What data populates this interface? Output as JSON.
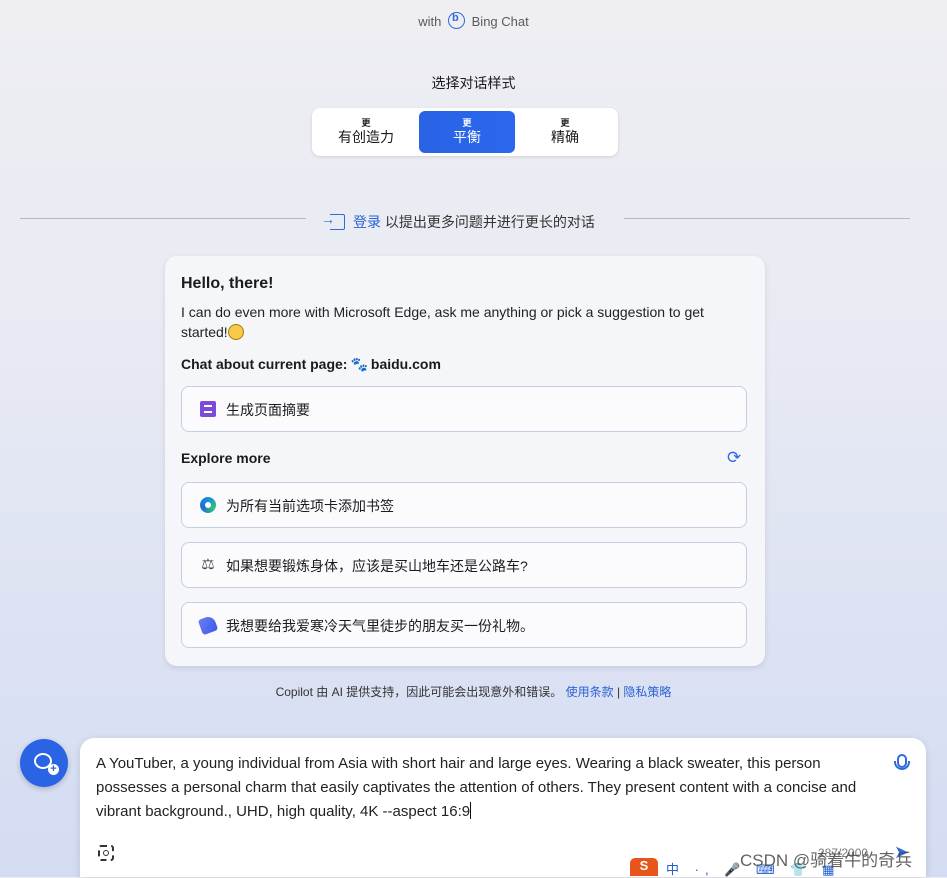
{
  "header": {
    "prefix": "with",
    "product": "Bing Chat"
  },
  "style_selector": {
    "title": "选择对话样式",
    "options": [
      {
        "more": "更",
        "label": "有创造力",
        "selected": false
      },
      {
        "more": "更",
        "label": "平衡",
        "selected": true
      },
      {
        "more": "更",
        "label": "精确",
        "selected": false
      }
    ]
  },
  "login": {
    "link": "登录",
    "text": " 以提出更多问题并进行更长的对话"
  },
  "welcome": {
    "title": "Hello, there!",
    "intro": "I can do even more with Microsoft Edge, ask me anything or pick a suggestion to get started!",
    "current_page_label": "Chat about current page:",
    "current_page_site": "baidu.com",
    "page_suggestion": {
      "icon": "document-icon",
      "text": "生成页面摘要"
    },
    "explore_label": "Explore more",
    "suggestions": [
      {
        "icon": "edge-icon",
        "text": "为所有当前选项卡添加书签"
      },
      {
        "icon": "scale-icon",
        "text": "如果想要锻炼身体，应该是买山地车还是公路车?"
      },
      {
        "icon": "tag-icon",
        "text": "我想要给我爱寒冷天气里徒步的朋友买一份礼物。"
      }
    ]
  },
  "footer": {
    "disclaimer": "Copilot 由 AI 提供支持，因此可能会出现意外和错误。",
    "terms": "使用条款",
    "separator": " | ",
    "privacy": "隐私策略"
  },
  "composer": {
    "text": "A YouTuber, a young individual from Asia with short hair and large eyes. Wearing a black sweater, this person possesses a personal charm that easily captivates the attention of others. They present content with a concise and vibrant background., UHD, high quality, 4K --aspect 16:9",
    "counter": "287/2000"
  },
  "ime_toolbar": {
    "logo": "S",
    "items": "中 ·, 🎤 ⌨ 👕 ▦"
  },
  "watermark": "CSDN @骑着牛的奇兵",
  "colors": {
    "accent": "#2a63e4",
    "link": "#2b62d6",
    "ime": "#e8551a"
  }
}
